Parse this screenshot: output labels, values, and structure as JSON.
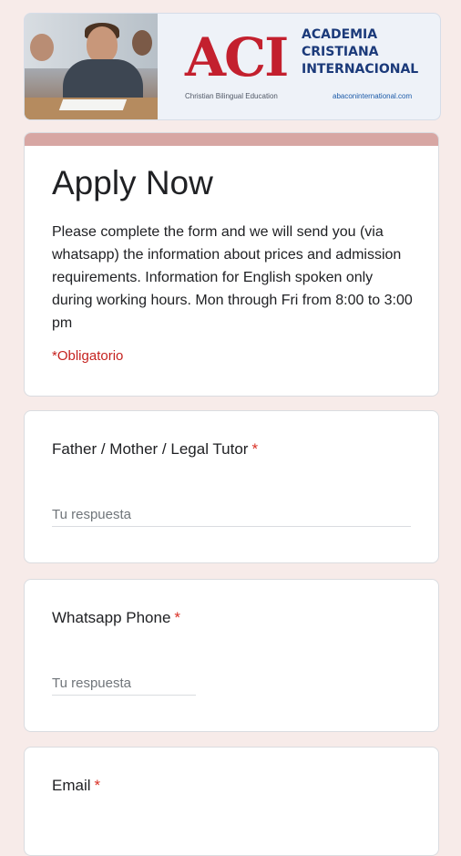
{
  "banner": {
    "logo_letters": "ACI",
    "school_name": "ACADEMIA CRISTIANA INTERNACIONAL",
    "tagline": "Christian Bilingual Education",
    "url": "abaconinternational.com"
  },
  "form": {
    "title": "Apply Now",
    "description": "Please complete the form and we will send you (via whatsapp) the information about prices and admission requirements.  Information for English spoken only during working hours.  Mon through Fri from 8:00 to 3:00 pm",
    "required_note": "*Obligatorio",
    "accent_color": "#d7a6a3",
    "required_color": "#d93025"
  },
  "questions": [
    {
      "label": "Father / Mother / Legal Tutor",
      "required_mark": "*",
      "placeholder": "Tu respuesta",
      "value": ""
    },
    {
      "label": "Whatsapp Phone",
      "required_mark": "*",
      "placeholder": "Tu respuesta",
      "value": ""
    },
    {
      "label": "Email",
      "required_mark": "*"
    }
  ]
}
